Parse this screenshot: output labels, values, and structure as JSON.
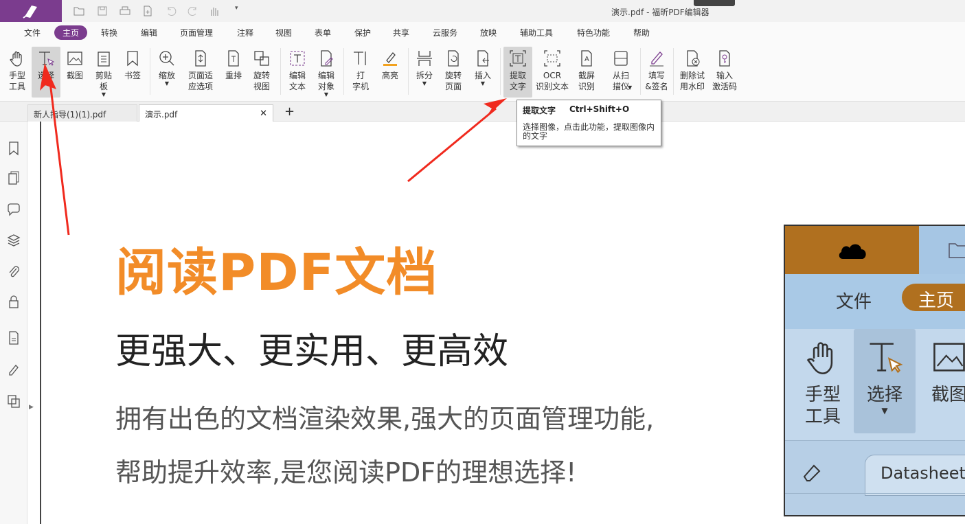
{
  "app": {
    "window_title": "演示.pdf - 福昕PDF编辑器",
    "accent_color": "#7b3c8e"
  },
  "quick_access": [
    "open-folder-icon",
    "save-icon",
    "print-icon",
    "new-file-icon",
    "undo-icon",
    "redo-icon",
    "hand-icon",
    "customize-arrow-icon"
  ],
  "menu": {
    "items": [
      "文件",
      "主页",
      "转换",
      "编辑",
      "页面管理",
      "注释",
      "视图",
      "表单",
      "保护",
      "共享",
      "云服务",
      "放映",
      "辅助工具",
      "特色功能",
      "帮助"
    ],
    "active": "主页"
  },
  "ribbon": {
    "tools": [
      {
        "id": "hand",
        "label": "手型\n工具"
      },
      {
        "id": "select",
        "label": "选择"
      },
      {
        "id": "snapshot",
        "label": "截图"
      },
      {
        "id": "clipboard",
        "label": "剪贴\n板"
      },
      {
        "id": "bookmark",
        "label": "书签"
      },
      {
        "id": "zoom",
        "label": "缩放"
      },
      {
        "id": "fit-page",
        "label": "页面适\n应选项"
      },
      {
        "id": "reflow",
        "label": "重排"
      },
      {
        "id": "rotate-view",
        "label": "旋转\n视图"
      },
      {
        "id": "edit-text",
        "label": "编辑\n文本"
      },
      {
        "id": "edit-object",
        "label": "编辑\n对象"
      },
      {
        "id": "typewriter",
        "label": "打\n字机"
      },
      {
        "id": "highlight",
        "label": "高亮"
      },
      {
        "id": "split",
        "label": "拆分"
      },
      {
        "id": "rotate-page",
        "label": "旋转\n页面"
      },
      {
        "id": "insert",
        "label": "插入"
      },
      {
        "id": "extract-text",
        "label": "提取\n文字"
      },
      {
        "id": "ocr",
        "label": "OCR\n识别文本"
      },
      {
        "id": "screenshot-ocr",
        "label": "截屏\n识别"
      },
      {
        "id": "from-scanner",
        "label": "从扫\n描仪"
      },
      {
        "id": "fill-sign",
        "label": "填写\n&签名"
      },
      {
        "id": "remove-watermark",
        "label": "删除试\n用水印"
      },
      {
        "id": "activation",
        "label": "输入\n激活码"
      }
    ]
  },
  "tabs": [
    {
      "label": "新人指导(1)(1).pdf",
      "active": false
    },
    {
      "label": "演示.pdf",
      "active": true
    }
  ],
  "new_tab_label": "+",
  "tooltip": {
    "title": "提取文字",
    "shortcut": "Ctrl+Shift+O",
    "description": "选择图像，点击此功能，提取图像内的文字"
  },
  "side_panel": [
    "bookmark-icon",
    "pages-icon",
    "comment-icon",
    "layers-icon",
    "attachment-icon",
    "security-icon",
    "form-fields-icon",
    "signature-icon",
    "page-compare-icon"
  ],
  "document": {
    "title": "阅读PDF文档",
    "subtitle": "更强大、更实用、更高效",
    "body_line1": "拥有出色的文档渲染效果,强大的页面管理功能,",
    "body_line2": "帮助提升效率,是您阅读PDF的理想选择!",
    "title_color": "#f28c28",
    "inset": {
      "menu_file": "文件",
      "menu_home": "主页",
      "tool_hand": "手型\n工具",
      "tool_select": "选择",
      "tool_snapshot": "截图",
      "doc_tab": "Datasheet_"
    }
  }
}
